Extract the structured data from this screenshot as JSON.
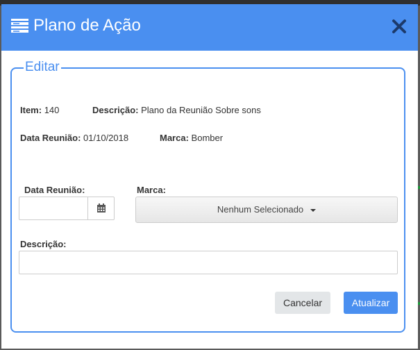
{
  "modal": {
    "title": "Plano de Ação",
    "header_icon": "list-icon",
    "close_icon": "close-icon"
  },
  "fieldset": {
    "legend": "Editar"
  },
  "summary": {
    "item_label": "Item:",
    "item_value": "140",
    "description_label": "Descrição:",
    "description_value": "Plano da Reunião Sobre sons",
    "meeting_date_label": "Data Reunião:",
    "meeting_date_value": "01/10/2018",
    "brand_label": "Marca:",
    "brand_value": "Bomber"
  },
  "form": {
    "meeting_date_label": "Data Reunião:",
    "meeting_date_value": "",
    "calendar_icon": "calendar-icon",
    "brand_label": "Marca:",
    "brand_selected": "Nenhum Selecionado",
    "description_label": "Descrição:",
    "description_value": ""
  },
  "actions": {
    "cancel_label": "Cancelar",
    "update_label": "Atualizar"
  },
  "colors": {
    "header_bg": "#4a8ff0",
    "accent": "#4a8ff0",
    "cancel_bg": "#e3e6e8"
  }
}
